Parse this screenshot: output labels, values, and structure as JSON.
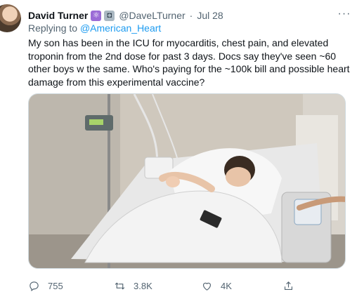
{
  "author": {
    "name": "David Turner",
    "handle": "@DaveLTurner",
    "date": "Jul 28",
    "badges": [
      "atom-emoji",
      "robot-emoji"
    ]
  },
  "reply": {
    "prefix": "Replying to",
    "to": "@American_Heart"
  },
  "text": "My son has been in the ICU for myocarditis, chest pain, and elevated troponin from the 2nd dose for past 3 days. Docs say they've seen ~60 other boys w the same. Who's paying for the ~100k bill and possible heart damage from this experimental vaccine?",
  "media": {
    "alt": "photo",
    "icons": [
      "hospital-bed",
      "iv-pump",
      "patient"
    ]
  },
  "actions": {
    "replies": "755",
    "retweets": "3.8K",
    "likes": "4K"
  },
  "colors": {
    "link": "#1d9bf0",
    "secondary": "#536471",
    "text": "#0f1419"
  }
}
